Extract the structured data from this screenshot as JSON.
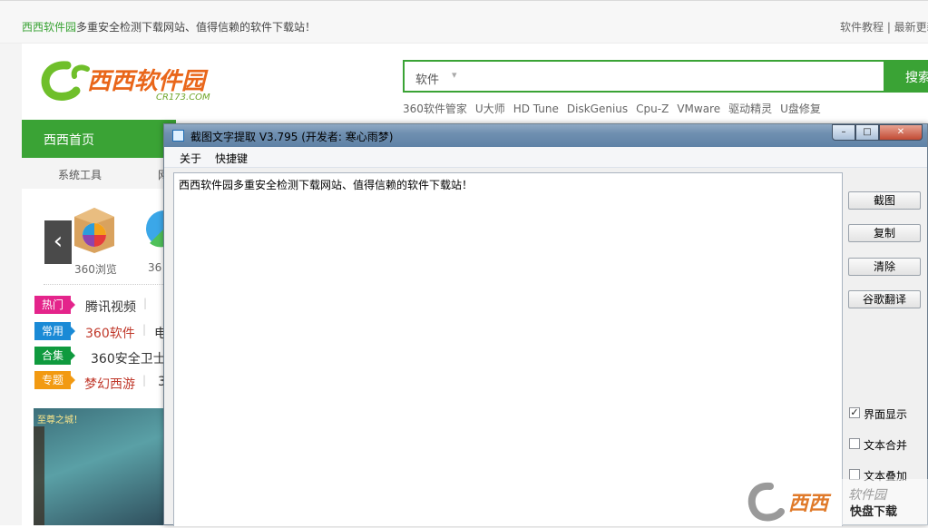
{
  "site": {
    "top_brand": "西西软件园",
    "top_slogan": "多重安全检测下载网站、值得信赖的软件下载站！",
    "top_right": "软件教程 | 最新更新",
    "logo_text": "西西软件园",
    "logo_sub": "CR173.COM",
    "search": {
      "category": "软件",
      "button": "搜索"
    },
    "hot_links": [
      "360软件管家",
      "U大师",
      "HD Tune",
      "DiskGenius",
      "Cpu-Z",
      "VMware",
      "驱动精灵",
      "U盘修复"
    ],
    "nav": {
      "home": "西西首页"
    },
    "subnav": {
      "item1": "系统工具",
      "item2": "网"
    },
    "apps": [
      {
        "label": "360浏览"
      },
      {
        "label": "36"
      }
    ],
    "rows": [
      {
        "tag": "热门",
        "text": "腾讯视频",
        "extra": "",
        "color": "#333333"
      },
      {
        "tag": "常用",
        "text": "360软件",
        "extra": "电",
        "color": "#c0392b"
      },
      {
        "tag": "合集",
        "text": "360安全卫士",
        "extra": "",
        "color": "#333333"
      },
      {
        "tag": "专题",
        "text": "梦幻西游",
        "extra": "3",
        "color": "#c0392b"
      }
    ],
    "banner_title": "至尊之城！"
  },
  "dialog": {
    "title": "截图文字提取 V3.795 (开发者: 寒心雨梦)",
    "menu": [
      "关于",
      "快捷键"
    ],
    "text_content": "西西软件园多重安全检测下载网站、值得信赖的软件下载站！",
    "buttons": [
      "截图",
      "复制",
      "清除",
      "谷歌翻译"
    ],
    "checkboxes": [
      {
        "label": "界面显示",
        "checked": true
      },
      {
        "label": "文本合并",
        "checked": false
      },
      {
        "label": "文本叠加",
        "checked": false
      }
    ],
    "window_controls": {
      "minimize": "–",
      "maximize": "□",
      "close": "✕"
    }
  },
  "watermark": {
    "brand": "西西",
    "text": "软件园",
    "sub": "快盘下载"
  },
  "colors": {
    "brand_green": "#3aa335",
    "hot_tag": "#e4248b",
    "common_tag": "#1a8ad6",
    "collection_tag": "#0f9a3e",
    "topic_tag": "#f29a12"
  }
}
